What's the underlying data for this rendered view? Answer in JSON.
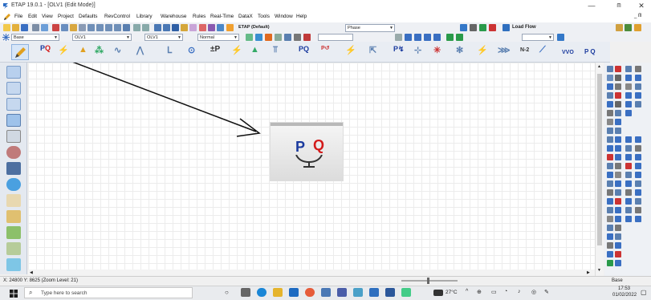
{
  "window": {
    "title": "ETAP 19.0.1 - [OLV1 (Edit Mode)]",
    "minimize_glyph": "—",
    "restore_glyph": "ᗰ",
    "close_glyph": "✕",
    "inner_restore_glyph": "_ ᗰ"
  },
  "menu": [
    "File",
    "Edit",
    "View",
    "Project",
    "Defaults",
    "RevControl",
    "Library",
    "Warehouse",
    "Rules",
    "Real-Time",
    "DataX",
    "Tools",
    "Window",
    "Help"
  ],
  "toolbar1": {
    "config_label": "ETAP (Default)",
    "phase_label": "Phase",
    "load_flow_label": "Load Flow"
  },
  "toolbar2": {
    "base_label": "Base",
    "olv_combo_1": "OLV1",
    "olv_combo_2": "OLV1",
    "normal_label": "Normal"
  },
  "palette": {
    "pq_label": "P Q",
    "n2_label": "N-2",
    "vvo_label": "VVO",
    "pq2_label": "P Q"
  },
  "zoomed_icon": {
    "p_letter": "P",
    "q_letter": "Q"
  },
  "status": {
    "coords": "X: 24800  Y: 8625 (Zoom Level: 21)",
    "right_label": "Base"
  },
  "taskbar": {
    "search_placeholder": "Type here to search",
    "weather": "27°C",
    "time": "17:53",
    "date": "01/02/2022"
  },
  "colors": {
    "p_color": "#1a3a9e",
    "q_color": "#d31b1b",
    "arrow_color": "#111111",
    "canvas_grid": "#ececec"
  }
}
